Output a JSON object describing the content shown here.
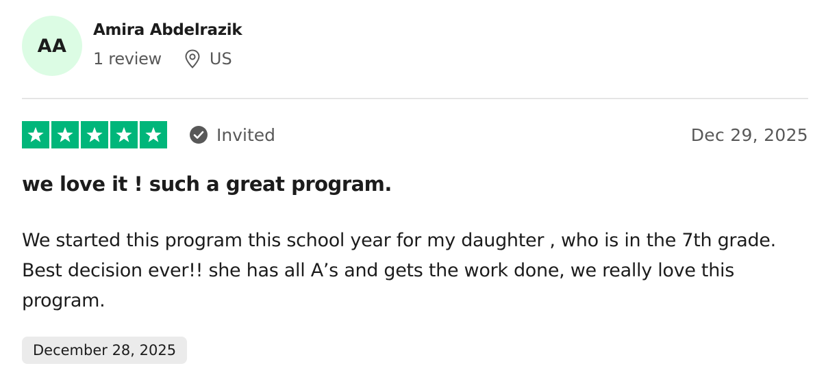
{
  "reviewer": {
    "initials": "AA",
    "name": "Amira Abdelrazik",
    "review_count": "1 review",
    "location": "US",
    "avatar_color": "#dcfce4"
  },
  "rating": {
    "stars": 5,
    "max_stars": 5,
    "star_color": "#00b67a",
    "status_label": "Invited",
    "date": "Dec 29, 2025"
  },
  "review": {
    "title": "we love it ! such a great program.",
    "body": "We started this program this school year for my daughter , who is in the 7th grade. Best decision ever!! she has all A’s and gets the work done, we really love this program.",
    "experience_date": "December 28, 2025"
  },
  "icons": {
    "location": "location-pin-icon",
    "status": "check-circle-icon",
    "star": "star-icon"
  }
}
